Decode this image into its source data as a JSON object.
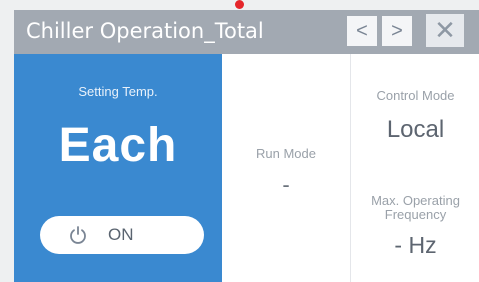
{
  "window": {
    "title": "Chiller Operation_Total",
    "prev_label": "<",
    "next_label": ">",
    "close_label": "✕"
  },
  "setting": {
    "label": "Setting Temp.",
    "value": "Each",
    "power_label": "ON",
    "power_icon": "power-icon"
  },
  "run_mode": {
    "label": "Run Mode",
    "value": "-"
  },
  "control_mode": {
    "label": "Control Mode",
    "value": "Local"
  },
  "max_frequency": {
    "label_line1": "Max. Operating",
    "label_line2": "Frequency",
    "value": "- Hz"
  },
  "colors": {
    "accent_blue": "#3a89d0",
    "titlebar": "#a2a9b2",
    "marker": "#e5262b"
  }
}
